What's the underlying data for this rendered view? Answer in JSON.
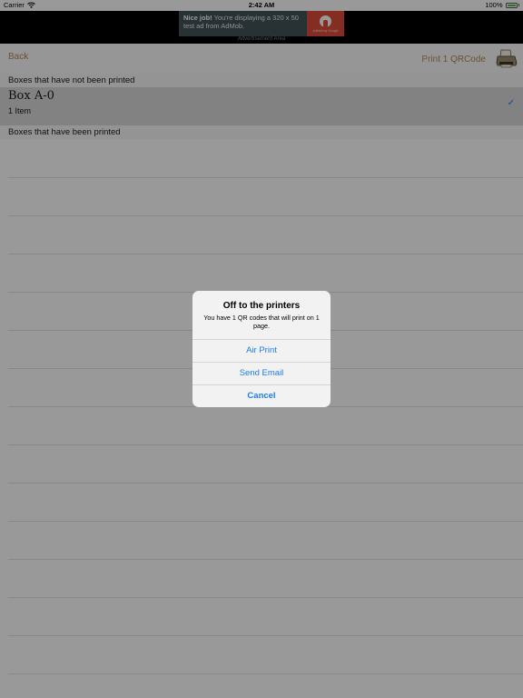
{
  "status_bar": {
    "carrier": "Carrier",
    "time": "2:42 AM",
    "battery": "100%",
    "wifi_icon": "wifi-icon",
    "battery_icon": "battery-icon"
  },
  "ad": {
    "headline": "Nice job!",
    "body": "You're displaying a 320 x 50 test ad from AdMob.",
    "logo_caption": "AdMob by Google",
    "area_label": "Advertisement Area"
  },
  "nav": {
    "back_label": "Back",
    "print_label": "Print 1 QRCode",
    "printer_icon": "printer-icon"
  },
  "list": {
    "section_not_printed": "Boxes that have not been printed",
    "section_printed": "Boxes that have been printed",
    "items": [
      {
        "title": "Box A-0",
        "count": "1 Item",
        "checkmark": "✓"
      }
    ]
  },
  "alert": {
    "title": "Off to the printers",
    "message": "You have 1 QR codes that will print on 1 page.",
    "actions": {
      "air_print": "Air Print",
      "send_email": "Send Email",
      "cancel": "Cancel"
    }
  },
  "colors": {
    "accent": "#b08a55",
    "system_blue": "#1e7cf2",
    "ad_red": "#dd4b39"
  }
}
